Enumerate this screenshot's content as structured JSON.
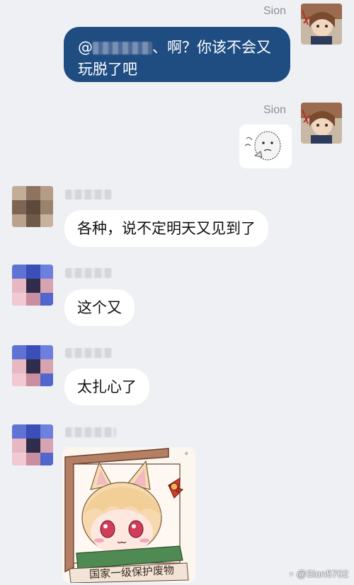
{
  "messages": [
    {
      "sender": "Sion",
      "text_before_mention": "@",
      "text_after_mention": "、啊？你该不会又玩脱了吧"
    },
    {
      "sender": "Sion",
      "sticker": "thinking-face-sticker"
    },
    {
      "text": "各种，说不定明天又见到了"
    },
    {
      "text": "这个又"
    },
    {
      "text": "太扎心了"
    },
    {
      "sticker": "anime-catgirl-sticker",
      "sticker_caption": "国家一级保护废物"
    }
  ],
  "watermark": "@Sion5702",
  "colors": {
    "background": "#eef0f4",
    "self_bubble": "#1f4d82",
    "other_bubble": "#ffffff"
  }
}
